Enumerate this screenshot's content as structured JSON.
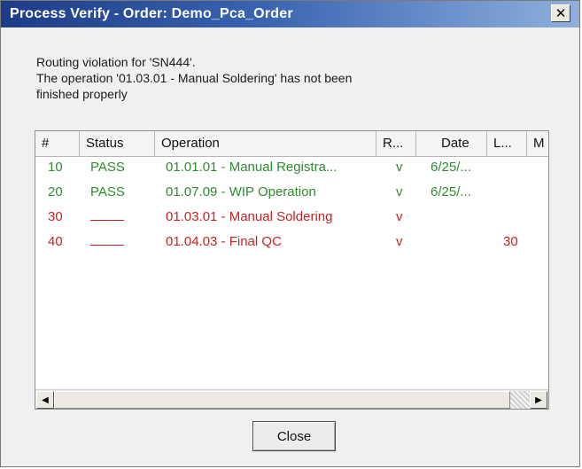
{
  "window": {
    "title": "Process Verify - Order: Demo_Pca_Order",
    "close_glyph": "✕"
  },
  "message": {
    "line1": "Routing violation for 'SN444'.",
    "line2": "The operation '01.03.01 - Manual Soldering' has not been",
    "line3": "finished properly"
  },
  "table": {
    "columns": [
      "#",
      "Status",
      "Operation",
      "R...",
      "Date",
      "L...",
      "M"
    ],
    "rows": [
      {
        "num": "10",
        "status": "PASS",
        "operation": "01.01.01 - Manual Registra...",
        "r": "v",
        "date": "6/25/...",
        "l": "",
        "state": "pass"
      },
      {
        "num": "20",
        "status": "PASS",
        "operation": "01.07.09 - WIP Operation",
        "r": "v",
        "date": "6/25/...",
        "l": "",
        "state": "pass"
      },
      {
        "num": "30",
        "status": "",
        "operation": "01.03.01 - Manual Soldering",
        "r": "v",
        "date": "",
        "l": "",
        "state": "fail"
      },
      {
        "num": "40",
        "status": "",
        "operation": "01.04.03 - Final QC",
        "r": "v",
        "date": "",
        "l": "30",
        "state": "fail"
      }
    ]
  },
  "scrollbar": {
    "left_icon": "arrow-left-icon",
    "right_icon": "arrow-right-icon"
  },
  "buttons": {
    "close_label": "Close"
  },
  "colors": {
    "pass": "#2e8b2e",
    "fail": "#cc1f1f",
    "title_start": "#1d3c87",
    "title_end": "#8fb0dd"
  }
}
